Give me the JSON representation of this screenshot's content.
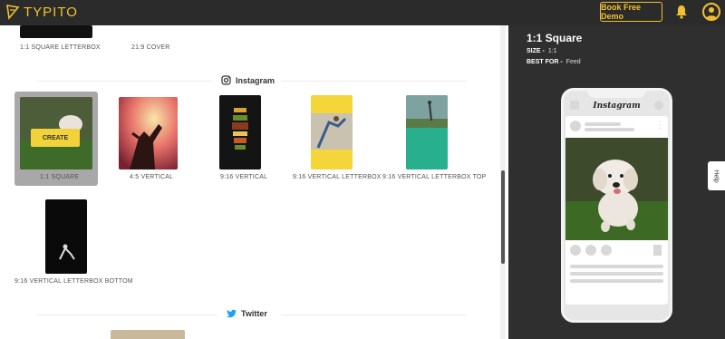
{
  "app": {
    "name": "TYPITO",
    "brand_color": "#f2c12e"
  },
  "header": {
    "demo_button": "Book Free Demo",
    "bell_icon": "bell-icon",
    "avatar_icon": "user-icon"
  },
  "top_row": [
    {
      "label": "1:1 SQUARE LETTERBOX"
    },
    {
      "label": "21:9 COVER"
    }
  ],
  "sections": {
    "instagram": {
      "title": "Instagram",
      "icon": "instagram-icon",
      "formats": [
        {
          "label": "1:1 SQUARE",
          "selected": true,
          "action": "CREATE"
        },
        {
          "label": "4:5 VERTICAL"
        },
        {
          "label": "9:16 VERTICAL"
        },
        {
          "label": "9:16 VERTICAL LETTERBOX"
        },
        {
          "label": "9:16 VERTICAL LETTERBOX TOP"
        },
        {
          "label": "9:16 VERTICAL LETTERBOX BOTTOM"
        }
      ]
    },
    "twitter": {
      "title": "Twitter",
      "icon": "twitter-icon"
    }
  },
  "preview": {
    "title": "1:1 Square",
    "size_label": "SIZE -",
    "size_value": "1:1",
    "best_for_label": "BEST FOR -",
    "best_for_value": "Feed",
    "phone_app_name": "Instagram"
  },
  "help": {
    "label": "Help"
  }
}
